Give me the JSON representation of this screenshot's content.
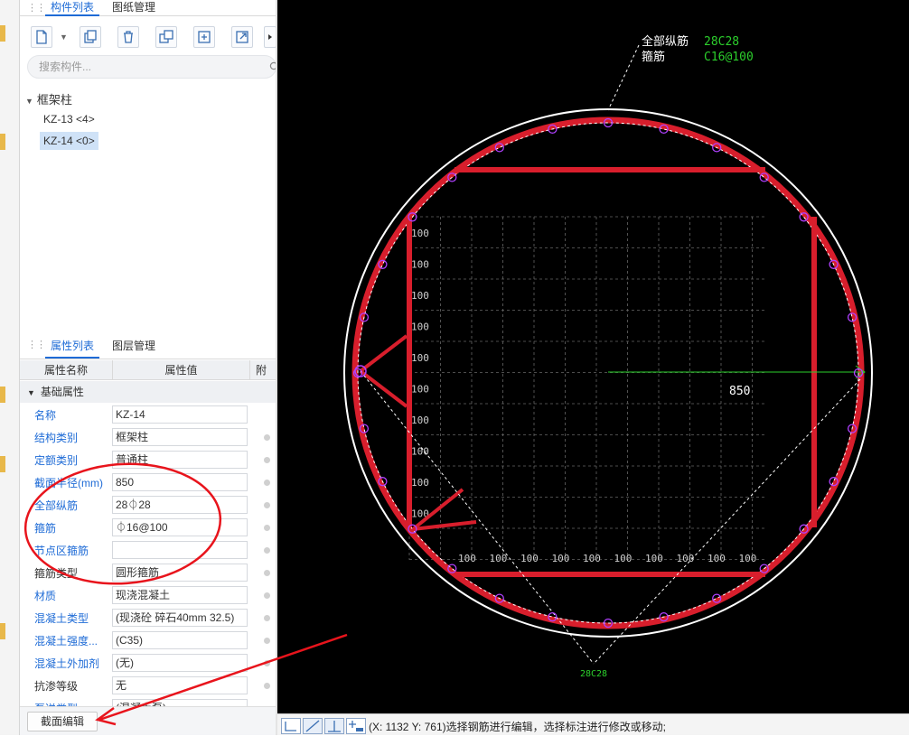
{
  "component_panel": {
    "tabs": [
      {
        "label": "构件列表",
        "active": true
      },
      {
        "label": "图纸管理",
        "active": false
      }
    ],
    "search_placeholder": "搜索构件...",
    "tree": {
      "root_label": "框架柱",
      "items": [
        {
          "label": "KZ-13 <4>",
          "selected": false
        },
        {
          "label": "KZ-14 <0>",
          "selected": true
        }
      ]
    }
  },
  "property_panel": {
    "tabs": [
      {
        "label": "属性列表",
        "active": true
      },
      {
        "label": "图层管理",
        "active": false
      }
    ],
    "headers": [
      "属性名称",
      "属性值",
      "附加"
    ],
    "group_label": "基础属性",
    "rows": [
      {
        "name": "名称",
        "value": "KZ-14",
        "color": "blue"
      },
      {
        "name": "结构类别",
        "value": "框架柱",
        "color": "blue"
      },
      {
        "name": "定额类别",
        "value": "普通柱",
        "color": "blue"
      },
      {
        "name": "截面半径(mm)",
        "value": "850",
        "color": "blue"
      },
      {
        "name": "全部纵筋",
        "value": "28⏀28",
        "color": "blue"
      },
      {
        "name": "箍筋",
        "value": "⏀16@100",
        "color": "blue"
      },
      {
        "name": "节点区箍筋",
        "value": "",
        "color": "blue"
      },
      {
        "name": "箍筋类型",
        "value": "圆形箍筋",
        "color": "black"
      },
      {
        "name": "材质",
        "value": "现浇混凝土",
        "color": "blue"
      },
      {
        "name": "混凝土类型",
        "value": "(现浇砼 碎石40mm 32.5)",
        "color": "blue"
      },
      {
        "name": "混凝土强度...",
        "value": "(C35)",
        "color": "blue"
      },
      {
        "name": "混凝土外加剂",
        "value": "(无)",
        "color": "blue"
      },
      {
        "name": "抗渗等级",
        "value": "无",
        "color": "black"
      },
      {
        "name": "泵送类型",
        "value": "(混凝土泵)",
        "color": "blue"
      }
    ],
    "section_edit_label": "截面编辑"
  },
  "canvas": {
    "label_all_longitudinal": "全部纵筋",
    "label_all_longitudinal_value": "28C28",
    "label_stirrup": "箍筋",
    "label_stirrup_value": "C16@100",
    "radius_label": "850",
    "grid_label": "100",
    "bottom_rebar_label": "28C28"
  },
  "status_bar": {
    "text": "(X: 1132 Y: 761)选择钢筋进行编辑，选择标注进行修改或移动;"
  },
  "colors": {
    "accent_blue": "#1e6bd6",
    "rebar_red": "#d81e2c",
    "rebar_circle_magenta": "#b040ff",
    "label_green": "#2ccf2c",
    "canvas_bg": "#000000",
    "annotation_red": "#e8141c"
  }
}
